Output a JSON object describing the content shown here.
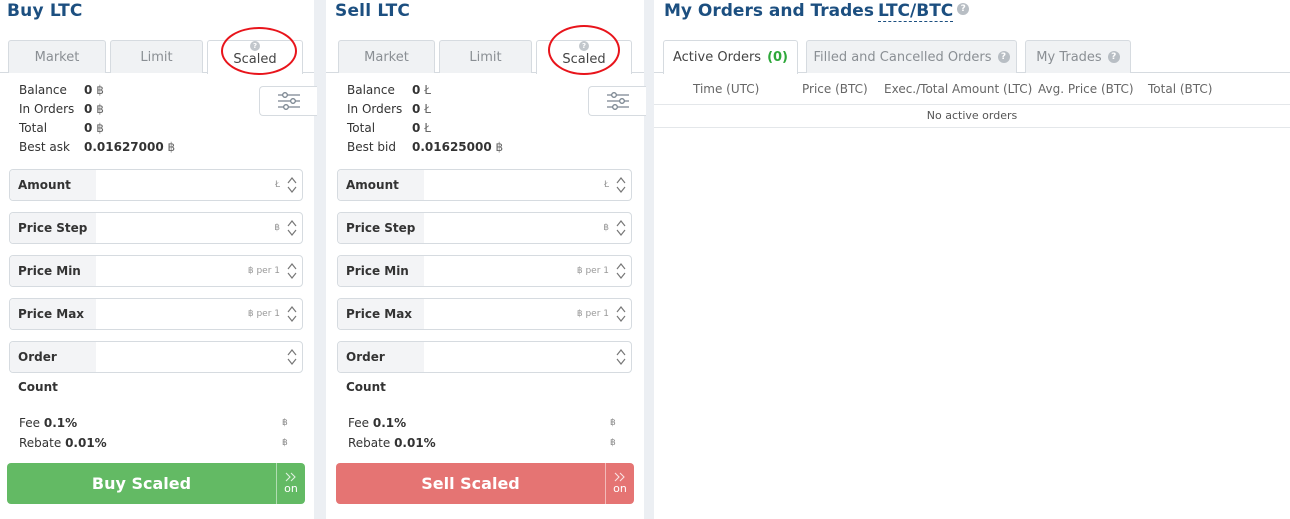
{
  "buy": {
    "title": "Buy LTC",
    "tabs": [
      "Market",
      "Limit",
      "Scaled"
    ],
    "balance_rows": [
      {
        "label": "Balance",
        "value": "0",
        "currency": "฿"
      },
      {
        "label": "In Orders",
        "value": "0",
        "currency": "฿"
      },
      {
        "label": "Total",
        "value": "0",
        "currency": "฿"
      },
      {
        "label": "Best ask",
        "value": "0.01627000",
        "currency": "฿"
      }
    ],
    "fields": [
      {
        "label": "Amount",
        "unit": "Ł"
      },
      {
        "label": "Price Step",
        "unit": "฿"
      },
      {
        "label": "Price Min",
        "unit": "฿ per 1"
      },
      {
        "label": "Price Max",
        "unit": "฿ per 1"
      },
      {
        "label": "Order Count",
        "unit": ""
      }
    ],
    "fee_label": "Fee",
    "fee_value": "0.1%",
    "fee_currency": "฿",
    "rebate_label": "Rebate",
    "rebate_value": "0.01%",
    "rebate_currency": "฿",
    "button_label": "Buy Scaled",
    "toggle_label": "on"
  },
  "sell": {
    "title": "Sell LTC",
    "tabs": [
      "Market",
      "Limit",
      "Scaled"
    ],
    "balance_rows": [
      {
        "label": "Balance",
        "value": "0",
        "currency": "Ł"
      },
      {
        "label": "In Orders",
        "value": "0",
        "currency": "Ł"
      },
      {
        "label": "Total",
        "value": "0",
        "currency": "Ł"
      },
      {
        "label": "Best bid",
        "value": "0.01625000",
        "currency": "฿"
      }
    ],
    "fields": [
      {
        "label": "Amount",
        "unit": "Ł"
      },
      {
        "label": "Price Step",
        "unit": "฿"
      },
      {
        "label": "Price Min",
        "unit": "฿ per 1"
      },
      {
        "label": "Price Max",
        "unit": "฿ per 1"
      },
      {
        "label": "Order Count",
        "unit": ""
      }
    ],
    "fee_label": "Fee",
    "fee_value": "0.1%",
    "fee_currency": "฿",
    "rebate_label": "Rebate",
    "rebate_value": "0.01%",
    "rebate_currency": "฿",
    "button_label": "Sell Scaled",
    "toggle_label": "on"
  },
  "orders": {
    "title": "My Orders and Trades",
    "pair": "LTC/BTC",
    "tabs": [
      {
        "label": "Active Orders",
        "count": "(0)"
      },
      {
        "label": "Filled and Cancelled Orders"
      },
      {
        "label": "My Trades"
      }
    ],
    "columns": [
      "Time (UTC)",
      "Price (BTC)",
      "Exec./Total Amount (LTC)",
      "Avg. Price (BTC)",
      "Total (BTC)"
    ],
    "empty_text": "No active orders"
  },
  "colors": {
    "title": "#1c4f80",
    "buy": "#63ba64",
    "sell": "#e57473",
    "highlight_circle": "#e8141b",
    "count_green": "#2ea83a"
  },
  "icons": {
    "settings": "sliders-icon",
    "help": "question-circle-icon",
    "spinner": "chevron-up-down-icon",
    "toggle": "double-chevron-right-icon"
  }
}
